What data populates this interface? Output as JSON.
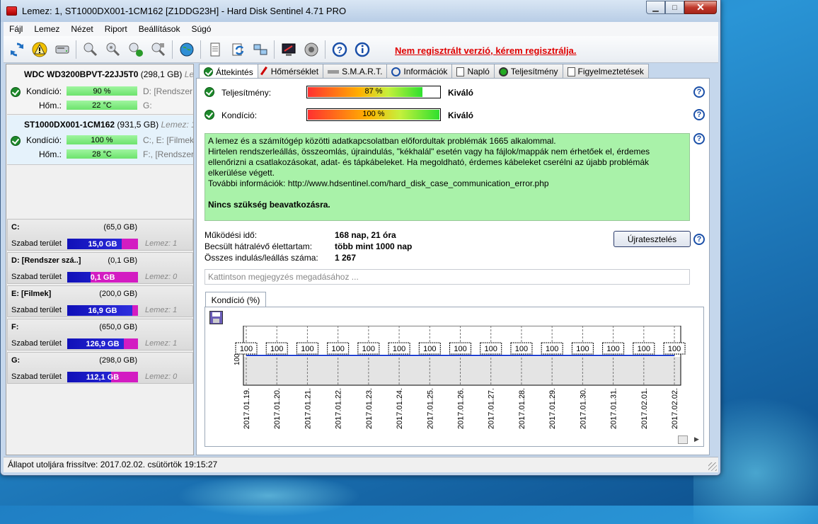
{
  "window": {
    "title": "Lemez: 1, ST1000DX001-1CM162 [Z1DDG23H]  -  Hard Disk Sentinel 4.71 PRO",
    "minimize_glyph": "▁",
    "maximize_glyph": "□",
    "close_glyph": "✕"
  },
  "menu": [
    "Fájl",
    "Lemez",
    "Nézet",
    "Riport",
    "Beállítások",
    "Súgó"
  ],
  "toolbar": {
    "register_link": "Nem regisztrált verzió, kérem regisztrálja."
  },
  "disks": [
    {
      "model": "WDC WD3200BPVT-22JJ5T0",
      "size": "(298,1 GB)",
      "suffix": "Len",
      "health_label": "Kondíció:",
      "health_value": "90 %",
      "health_fraction": 0.9,
      "temp_label": "Hőm.:",
      "temp_value": "22 °C",
      "vol1": "D: [Rendszer sz",
      "vol2": "G:"
    },
    {
      "model": "ST1000DX001-1CM162",
      "size": "(931,5 GB)",
      "suffix": "Lemez: 1",
      "health_label": "Kondíció:",
      "health_value": "100 %",
      "health_fraction": 1.0,
      "temp_label": "Hőm.:",
      "temp_value": "28 °C",
      "vol1": "C:, E: [Filmek]",
      "vol2": "F:,  [Rendszer"
    }
  ],
  "volumes": [
    {
      "name": "C:",
      "size": "(65,0 GB)",
      "free_label": "Szabad terület",
      "free": "15,0 GB",
      "used_fraction": 0.23,
      "disk": "Lemez: 1"
    },
    {
      "name": "D: [Rendszer szá..]",
      "size": "(0,1 GB)",
      "free_label": "Szabad terület",
      "free": "0,1 GB",
      "used_fraction": 0.67,
      "disk": "Lemez: 0"
    },
    {
      "name": "E: [Filmek]",
      "size": "(200,0 GB)",
      "free_label": "Szabad terület",
      "free": "16,9 GB",
      "used_fraction": 0.08,
      "disk": "Lemez: 1"
    },
    {
      "name": "F:",
      "size": "(650,0 GB)",
      "free_label": "Szabad terület",
      "free": "126,9 GB",
      "used_fraction": 0.2,
      "disk": "Lemez: 1"
    },
    {
      "name": "G:",
      "size": "(298,0 GB)",
      "free_label": "Szabad terület",
      "free": "112,1 GB",
      "used_fraction": 0.38,
      "disk": "Lemez: 0"
    }
  ],
  "tabs": [
    "Áttekintés",
    "Hőmérséklet",
    "S.M.A.R.T.",
    "Információk",
    "Napló",
    "Teljesítmény",
    "Figyelmeztetések"
  ],
  "overview": {
    "performance_label": "Teljesítmény:",
    "performance_value": "87 %",
    "performance_fraction": 0.87,
    "performance_rating": "Kiváló",
    "health_label": "Kondíció:",
    "health_value": "100 %",
    "health_fraction": 1.0,
    "health_rating": "Kiváló",
    "message_lines": [
      "A lemez és a számítógép közötti adatkapcsolatban előfordultak problémák 1665 alkalommal.",
      "Hirtelen rendszerleállás, összeomlás, újraindulás, \"kékhalál\" esetén vagy ha fájlok/mappák nem érhetőek el, érdemes ellenőrizni a csatlakozásokat, adat- és tápkábeleket. Ha megoldható, érdemes kábeleket cserélni az újabb problémák elkerülése végett.",
      "További információk: http://www.hdsentinel.com/hard_disk_case_communication_error.php"
    ],
    "message_action": "Nincs szükség beavatkozásra.",
    "power_on_label": "Működési idő:",
    "power_on_value": "168 nap, 21 óra",
    "lifetime_label": "Becsült hátralévő élettartam:",
    "lifetime_value": "több mint 1000 nap",
    "startstop_label": "Összes indulás/leállás száma:",
    "startstop_value": "1 267",
    "retest_button": "Újratesztelés",
    "note_placeholder": "Kattintson megjegyzés megadásához ...",
    "help_glyph": "?"
  },
  "chart_data": {
    "type": "line",
    "tab_label": "Kondíció  (%)",
    "x": [
      "2017.01.19.",
      "2017.01.20.",
      "2017.01.21.",
      "2017.01.22.",
      "2017.01.23.",
      "2017.01.24.",
      "2017.01.25.",
      "2017.01.26.",
      "2017.01.27.",
      "2017.01.28.",
      "2017.01.29.",
      "2017.01.30.",
      "2017.01.31.",
      "2017.02.01.",
      "2017.02.02."
    ],
    "series": [
      {
        "values": [
          100,
          100,
          100,
          100,
          100,
          100,
          100,
          100,
          100,
          100,
          100,
          100,
          100,
          100,
          100
        ]
      }
    ],
    "y_tick": "100",
    "ylim": [
      0,
      100
    ],
    "line_color": "#2040d0",
    "grid": true
  },
  "status": {
    "text": "Állapot utoljára frissítve: 2017.02.02. csütörtök 19:15:27"
  }
}
